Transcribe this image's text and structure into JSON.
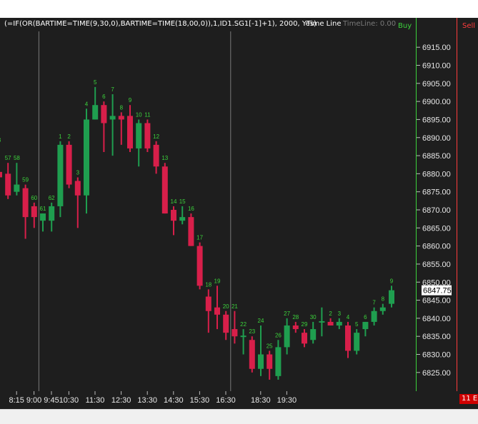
{
  "header": {
    "formula": "(=IF(OR(BARTIME=TIME(9,30,0),BARTIME=TIME(18,00,0)),1,ID1.SG1[-1]+1), 2000, Yes)",
    "indicator_name": "Time Line",
    "indicator_value": "TimeLine: 0.00"
  },
  "buy_label": "Buy",
  "sell_label": "Sell",
  "corner_badge": "11 E",
  "price_axis": {
    "ticks": [
      "6915.00",
      "6910.00",
      "6905.00",
      "6900.00",
      "6895.00",
      "6890.00",
      "6885.00",
      "6880.00",
      "6875.00",
      "6870.00",
      "6865.00",
      "6860.00",
      "6855.00",
      "6850.00",
      "6845.00",
      "6840.00",
      "6835.00",
      "6830.00",
      "6825.00"
    ],
    "tick_values": [
      6915,
      6910,
      6905,
      6900,
      6895,
      6890,
      6885,
      6880,
      6875,
      6870,
      6865,
      6860,
      6855,
      6850,
      6845,
      6840,
      6835,
      6830,
      6825
    ],
    "last_price": "6847.75",
    "last_price_value": 6847.75
  },
  "time_axis": {
    "labels": [
      "8:15",
      "9:00",
      "9:45",
      "10:30",
      "11:30",
      "12:30",
      "13:30",
      "14:30",
      "15:30",
      "16:30",
      "18:30",
      "19:30"
    ],
    "label_bar_index": [
      1,
      3,
      5,
      7,
      10,
      13,
      16,
      19,
      22,
      25,
      29,
      32
    ]
  },
  "session_lines_bar_index": [
    4.5,
    26.5
  ],
  "colors": {
    "background": "#1e1e1e",
    "up": "#1f9e4f",
    "down": "#d81f4a",
    "count_text": "#3cd23c",
    "grid_line": "#7a7a7a",
    "buy": "#3cd23c",
    "sell": "#ff3c3c"
  },
  "chart_data": {
    "type": "candlestick",
    "bars": [
      {
        "o": 6880.5,
        "h": 6888,
        "l": 6875,
        "c": 6879,
        "n": "3"
      },
      {
        "o": 6880,
        "h": 6883,
        "l": 6873,
        "c": 6874,
        "n": "57"
      },
      {
        "o": 6875,
        "h": 6883,
        "l": 6874,
        "c": 6877,
        "n": "58"
      },
      {
        "o": 6876,
        "h": 6877,
        "l": 6862,
        "c": 6868,
        "n": "59"
      },
      {
        "o": 6871,
        "h": 6872,
        "l": 6865,
        "c": 6868,
        "n": "60"
      },
      {
        "o": 6867,
        "h": 6869,
        "l": 6864,
        "c": 6869,
        "n": "61"
      },
      {
        "o": 6867,
        "h": 6872,
        "l": 6864,
        "c": 6871,
        "n": "62"
      },
      {
        "o": 6871,
        "h": 6889,
        "l": 6868,
        "c": 6888,
        "n": "1"
      },
      {
        "o": 6888,
        "h": 6889,
        "l": 6876,
        "c": 6877,
        "n": "2"
      },
      {
        "o": 6878,
        "h": 6879,
        "l": 6865,
        "c": 6874,
        "n": "3"
      },
      {
        "o": 6874,
        "h": 6898,
        "l": 6869,
        "c": 6895,
        "n": "4"
      },
      {
        "o": 6895,
        "h": 6904,
        "l": 6895,
        "c": 6899,
        "n": "5"
      },
      {
        "o": 6899,
        "h": 6900,
        "l": 6886,
        "c": 6894,
        "n": "6"
      },
      {
        "o": 6895,
        "h": 6902,
        "l": 6885,
        "c": 6896,
        "n": "7"
      },
      {
        "o": 6896,
        "h": 6897,
        "l": 6888,
        "c": 6895,
        "n": "8"
      },
      {
        "o": 6896,
        "h": 6899,
        "l": 6886,
        "c": 6887,
        "n": "9"
      },
      {
        "o": 6887,
        "h": 6895,
        "l": 6882,
        "c": 6894,
        "n": "10"
      },
      {
        "o": 6894,
        "h": 6895,
        "l": 6886,
        "c": 6887,
        "n": "11"
      },
      {
        "o": 6888,
        "h": 6889,
        "l": 6880,
        "c": 6882,
        "n": "12"
      },
      {
        "o": 6882,
        "h": 6883,
        "l": 6869,
        "c": 6869,
        "n": "13"
      },
      {
        "o": 6870,
        "h": 6871,
        "l": 6863,
        "c": 6867,
        "n": "14"
      },
      {
        "o": 6867,
        "h": 6871,
        "l": 6866,
        "c": 6868,
        "n": "15"
      },
      {
        "o": 6868,
        "h": 6869,
        "l": 6860,
        "c": 6860,
        "n": "16"
      },
      {
        "o": 6860,
        "h": 6861,
        "l": 6848,
        "c": 6849,
        "n": "17"
      },
      {
        "o": 6846,
        "h": 6848,
        "l": 6836,
        "c": 6842,
        "n": "18"
      },
      {
        "o": 6843,
        "h": 6849,
        "l": 6837,
        "c": 6841,
        "n": "19"
      },
      {
        "o": 6841,
        "h": 6842,
        "l": 6834,
        "c": 6836,
        "n": "20"
      },
      {
        "o": 6837,
        "h": 6842,
        "l": 6833,
        "c": 6835,
        "n": "21"
      },
      {
        "o": 6835,
        "h": 6837,
        "l": 6830,
        "c": 6835,
        "n": "22"
      },
      {
        "o": 6834,
        "h": 6835,
        "l": 6825,
        "c": 6826,
        "n": "23"
      },
      {
        "o": 6826,
        "h": 6838,
        "l": 6824,
        "c": 6830,
        "n": "24"
      },
      {
        "o": 6830,
        "h": 6831,
        "l": 6823,
        "c": 6826,
        "n": "25"
      },
      {
        "o": 6824,
        "h": 6834,
        "l": 6823,
        "c": 6832,
        "n": "26"
      },
      {
        "o": 6832,
        "h": 6840,
        "l": 6830,
        "c": 6838,
        "n": "27"
      },
      {
        "o": 6838,
        "h": 6839,
        "l": 6836,
        "c": 6837,
        "n": "28"
      },
      {
        "o": 6836,
        "h": 6837,
        "l": 6832,
        "c": 6833,
        "n": "29"
      },
      {
        "o": 6834,
        "h": 6839,
        "l": 6833,
        "c": 6837,
        "n": "30"
      },
      {
        "o": 6839,
        "h": 6843,
        "l": 6835,
        "c": 6839,
        "n": ""
      },
      {
        "o": 6839,
        "h": 6840,
        "l": 6838,
        "c": 6838,
        "n": "2"
      },
      {
        "o": 6838,
        "h": 6840,
        "l": 6837,
        "c": 6839,
        "n": "3"
      },
      {
        "o": 6838,
        "h": 6839,
        "l": 6829,
        "c": 6831,
        "n": "4"
      },
      {
        "o": 6831,
        "h": 6837,
        "l": 6830,
        "c": 6836,
        "n": "5"
      },
      {
        "o": 6837,
        "h": 6839,
        "l": 6835,
        "c": 6839,
        "n": "6"
      },
      {
        "o": 6839,
        "h": 6843,
        "l": 6838,
        "c": 6842,
        "n": "7"
      },
      {
        "o": 6842,
        "h": 6844,
        "l": 6841,
        "c": 6843,
        "n": "8"
      },
      {
        "o": 6844,
        "h": 6849,
        "l": 6843,
        "c": 6847.75,
        "n": "9"
      }
    ],
    "ylim": [
      6822,
      6918
    ]
  }
}
